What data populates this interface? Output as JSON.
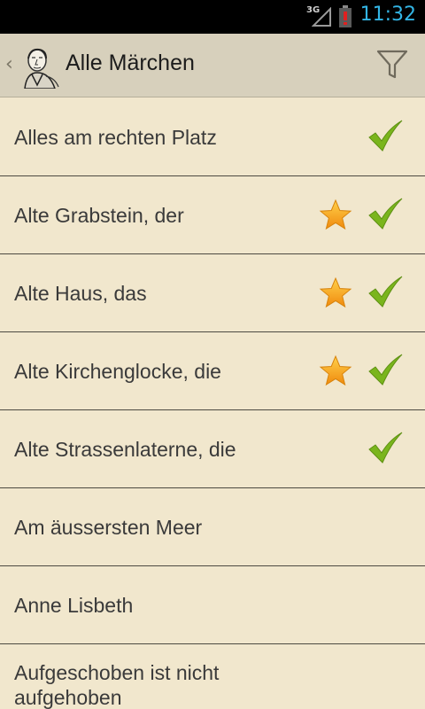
{
  "status_bar": {
    "network": "3G",
    "time": "11:32"
  },
  "action_bar": {
    "title": "Alle Märchen",
    "up_icon": "chevron-left-icon",
    "app_icon": "andersen-portrait-icon",
    "filter_icon": "filter-icon"
  },
  "colors": {
    "background": "#f1e7cd",
    "action_bar": "#d7d0bc",
    "time": "#33b5e5",
    "check": "#7ab51d",
    "star": "#f5a21b"
  },
  "items": [
    {
      "label": "Alles am rechten Platz",
      "favorite": false,
      "read": true
    },
    {
      "label": "Alte Grabstein, der",
      "favorite": true,
      "read": true
    },
    {
      "label": "Alte Haus, das",
      "favorite": true,
      "read": true
    },
    {
      "label": "Alte Kirchenglocke, die",
      "favorite": true,
      "read": true
    },
    {
      "label": "Alte Strassenlaterne, die",
      "favorite": false,
      "read": true
    },
    {
      "label": "Am äussersten Meer",
      "favorite": false,
      "read": false
    },
    {
      "label": "Anne Lisbeth",
      "favorite": false,
      "read": false
    },
    {
      "label": "Aufgeschoben ist nicht aufgehoben",
      "favorite": false,
      "read": false
    }
  ]
}
